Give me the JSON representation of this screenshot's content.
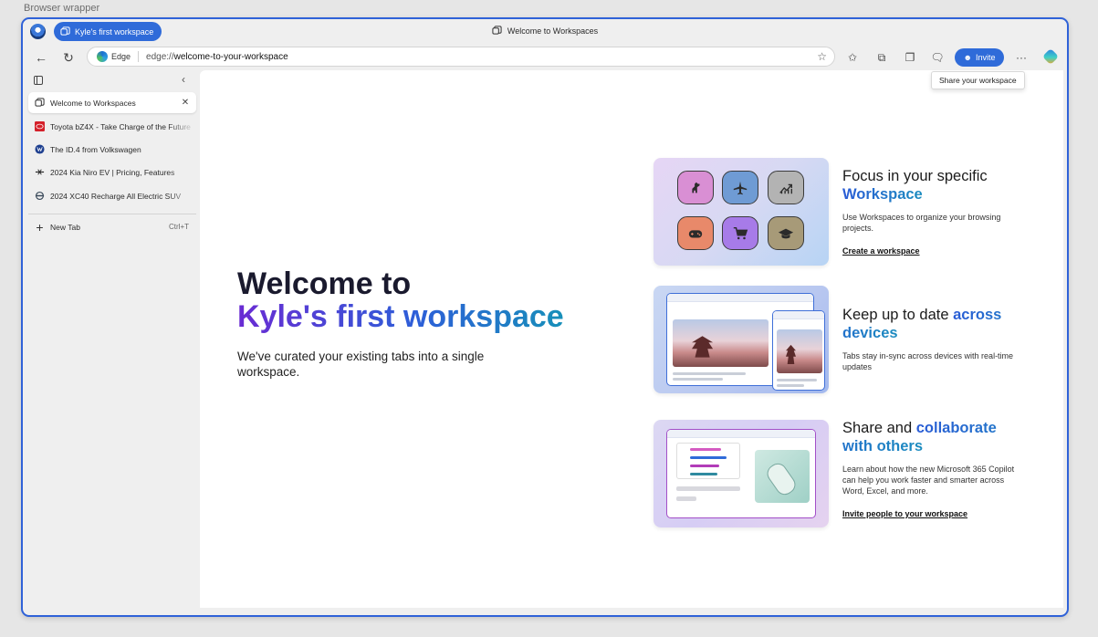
{
  "wrapper_label": "Browser wrapper",
  "titlebar": {
    "workspace_name": "Kyle's first workspace",
    "window_title": "Welcome to Workspaces"
  },
  "addressbar": {
    "browser_label": "Edge",
    "url_scheme": "edge://",
    "url_path": "welcome-to-your-workspace"
  },
  "toolbar": {
    "invite_label": "Invite",
    "more_label": "···",
    "tooltip": "Share your workspace"
  },
  "sidebar": {
    "tabs": [
      {
        "label": "Welcome to Workspaces",
        "icon": "workspaces-icon",
        "active": true
      },
      {
        "label": "Toyota bZ4X - Take Charge of the Future",
        "icon": "toyota-favicon"
      },
      {
        "label": "The ID.4 from Volkswagen",
        "icon": "volkswagen-favicon"
      },
      {
        "label": "2024 Kia Niro EV | Pricing, Features",
        "icon": "kia-favicon"
      },
      {
        "label": "2024 XC40 Recharge All Electric SUV",
        "icon": "volvo-favicon"
      }
    ],
    "new_tab_label": "New Tab",
    "new_tab_shortcut": "Ctrl+T"
  },
  "main": {
    "heading_line1": "Welcome to",
    "heading_line2": "Kyle's first workspace",
    "subtitle": "We've curated your existing tabs into a single workspace.",
    "features": [
      {
        "title_plain": "Focus in your specific",
        "title_accent": "Workspace",
        "description": "Use Workspaces to organize your browsing projects.",
        "link": "Create a workspace"
      },
      {
        "title_plain": "Keep up to date",
        "title_accent": "across devices",
        "description": "Tabs stay in-sync across devices with real-time updates",
        "link": ""
      },
      {
        "title_plain": "Share and",
        "title_accent": "collaborate with others",
        "description": "Learn about how the new Microsoft 365 Copilot can help you work faster and smarter across Word, Excel, and more.",
        "link": "Invite people to your workspace"
      }
    ],
    "tile_colors": [
      "#d98fd4",
      "#6f9bd4",
      "#b3b3b3",
      "#e8896a",
      "#a77be8",
      "#a79a78"
    ]
  }
}
